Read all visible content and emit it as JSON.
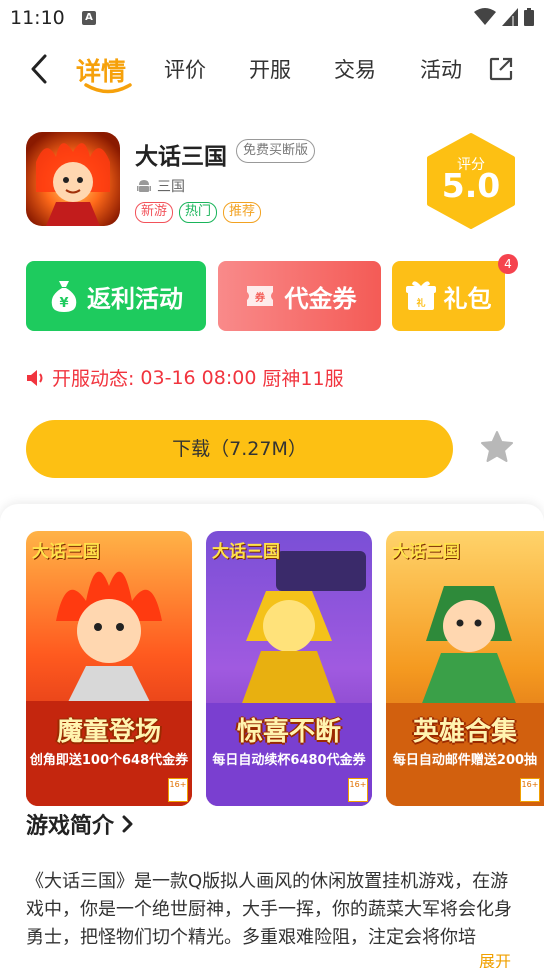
{
  "status_bar": {
    "time": "11:10",
    "notification_icon": "A"
  },
  "nav": {
    "tabs": [
      {
        "label": "详情",
        "active": true
      },
      {
        "label": "评价"
      },
      {
        "label": "开服"
      },
      {
        "label": "交易"
      },
      {
        "label": "活动"
      }
    ]
  },
  "game": {
    "title": "大话三国",
    "edition": "免费买断版",
    "platform": "三国",
    "tags": [
      "新游",
      "热门",
      "推荐"
    ],
    "score_label": "评分",
    "score": "5.0"
  },
  "actions": {
    "rebate": "返利活动",
    "voucher": "代金券",
    "gift": "礼包",
    "gift_badge": "4"
  },
  "server": {
    "label": "开服动态:",
    "time": "03-16 08:00",
    "name": "厨神11服"
  },
  "download": {
    "label": "下载（7.27M）"
  },
  "screenshots": [
    {
      "logo": "大话三国",
      "caption": "魔童登场",
      "sub": "创角即送100个648代金券",
      "age": "16+"
    },
    {
      "logo": "大话三国",
      "caption": "惊喜不断",
      "sub": "每日自动续杯6480代金券",
      "age": "16+"
    },
    {
      "logo": "大话三国",
      "caption": "英雄合集",
      "sub": "每日自动邮件赠送200抽",
      "age": "16+"
    }
  ],
  "intro": {
    "title": "游戏简介",
    "text": "《大话三国》是一款Q版拟人画风的休闲放置挂机游戏，在游戏中，你是一个绝世厨神，大手一挥，你的蔬菜大军将会化身勇士，把怪物们切个精光。多重艰难险阻，注定会将你培",
    "expand": "展开"
  },
  "colors": {
    "accent": "#f6a10b",
    "rebate_bg": "#1ecb5e",
    "voucher_bg": "#f45b56",
    "gift_bg": "#fdbf17",
    "download_bg": "#fdc013",
    "server_text": "#f1343e"
  }
}
